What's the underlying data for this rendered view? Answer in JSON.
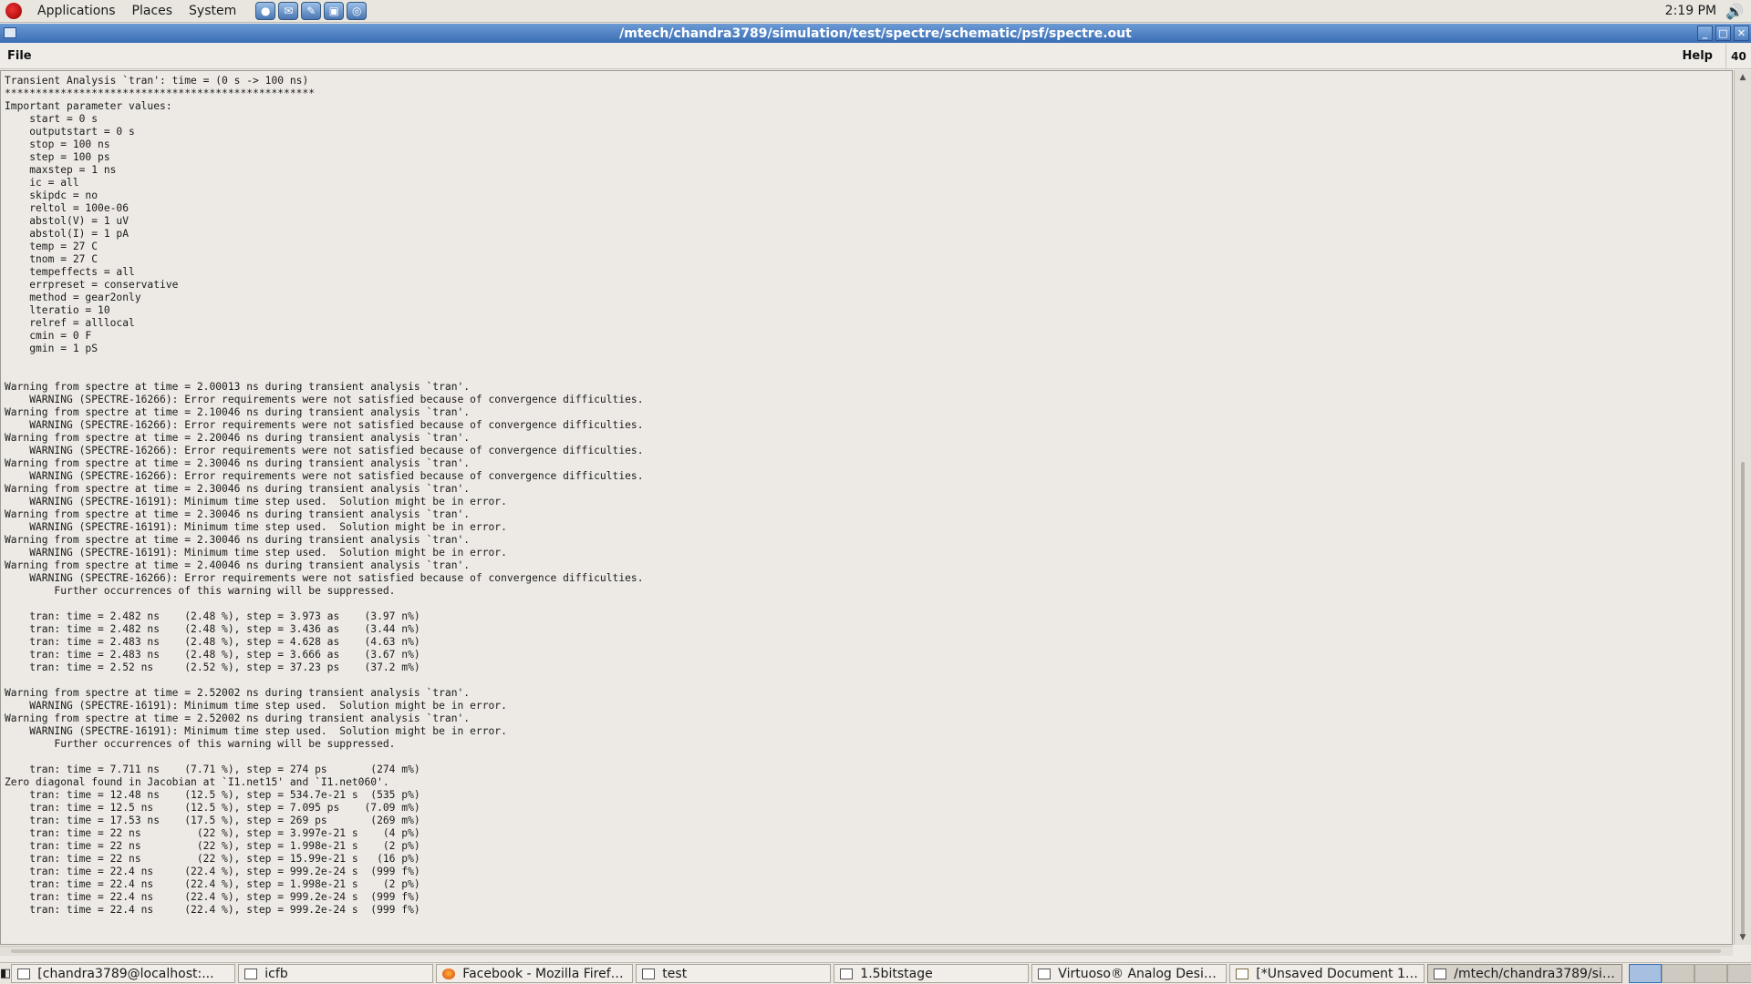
{
  "top_panel": {
    "menus": [
      "Applications",
      "Places",
      "System"
    ],
    "launchers": [
      "browser-icon",
      "email-icon",
      "editor-icon",
      "terminal-icon",
      "network-icon"
    ],
    "clock": "2:19 PM"
  },
  "window": {
    "title": "/mtech/chandra3789/simulation/test/spectre/schematic/psf/spectre.out",
    "controls": [
      "minimize",
      "maximize",
      "close"
    ]
  },
  "menubar": {
    "file": "File",
    "help": "Help",
    "counter": "40"
  },
  "log_lines": [
    "Transient Analysis `tran': time = (0 s -> 100 ns)",
    "**************************************************",
    "Important parameter values:",
    "    start = 0 s",
    "    outputstart = 0 s",
    "    stop = 100 ns",
    "    step = 100 ps",
    "    maxstep = 1 ns",
    "    ic = all",
    "    skipdc = no",
    "    reltol = 100e-06",
    "    abstol(V) = 1 uV",
    "    abstol(I) = 1 pA",
    "    temp = 27 C",
    "    tnom = 27 C",
    "    tempeffects = all",
    "    errpreset = conservative",
    "    method = gear2only",
    "    lteratio = 10",
    "    relref = alllocal",
    "    cmin = 0 F",
    "    gmin = 1 pS",
    "",
    "",
    "Warning from spectre at time = 2.00013 ns during transient analysis `tran'.",
    "    WARNING (SPECTRE-16266): Error requirements were not satisfied because of convergence difficulties.",
    "Warning from spectre at time = 2.10046 ns during transient analysis `tran'.",
    "    WARNING (SPECTRE-16266): Error requirements were not satisfied because of convergence difficulties.",
    "Warning from spectre at time = 2.20046 ns during transient analysis `tran'.",
    "    WARNING (SPECTRE-16266): Error requirements were not satisfied because of convergence difficulties.",
    "Warning from spectre at time = 2.30046 ns during transient analysis `tran'.",
    "    WARNING (SPECTRE-16266): Error requirements were not satisfied because of convergence difficulties.",
    "Warning from spectre at time = 2.30046 ns during transient analysis `tran'.",
    "    WARNING (SPECTRE-16191): Minimum time step used.  Solution might be in error.",
    "Warning from spectre at time = 2.30046 ns during transient analysis `tran'.",
    "    WARNING (SPECTRE-16191): Minimum time step used.  Solution might be in error.",
    "Warning from spectre at time = 2.30046 ns during transient analysis `tran'.",
    "    WARNING (SPECTRE-16191): Minimum time step used.  Solution might be in error.",
    "Warning from spectre at time = 2.40046 ns during transient analysis `tran'.",
    "    WARNING (SPECTRE-16266): Error requirements were not satisfied because of convergence difficulties.",
    "        Further occurrences of this warning will be suppressed.",
    "",
    "    tran: time = 2.482 ns    (2.48 %), step = 3.973 as    (3.97 n%)",
    "    tran: time = 2.482 ns    (2.48 %), step = 3.436 as    (3.44 n%)",
    "    tran: time = 2.483 ns    (2.48 %), step = 4.628 as    (4.63 n%)",
    "    tran: time = 2.483 ns    (2.48 %), step = 3.666 as    (3.67 n%)",
    "    tran: time = 2.52 ns     (2.52 %), step = 37.23 ps    (37.2 m%)",
    "",
    "Warning from spectre at time = 2.52002 ns during transient analysis `tran'.",
    "    WARNING (SPECTRE-16191): Minimum time step used.  Solution might be in error.",
    "Warning from spectre at time = 2.52002 ns during transient analysis `tran'.",
    "    WARNING (SPECTRE-16191): Minimum time step used.  Solution might be in error.",
    "        Further occurrences of this warning will be suppressed.",
    "",
    "    tran: time = 7.711 ns    (7.71 %), step = 274 ps       (274 m%)",
    "Zero diagonal found in Jacobian at `I1.net15' and `I1.net060'.",
    "    tran: time = 12.48 ns    (12.5 %), step = 534.7e-21 s  (535 p%)",
    "    tran: time = 12.5 ns     (12.5 %), step = 7.095 ps    (7.09 m%)",
    "    tran: time = 17.53 ns    (17.5 %), step = 269 ps       (269 m%)",
    "    tran: time = 22 ns         (22 %), step = 3.997e-21 s    (4 p%)",
    "    tran: time = 22 ns         (22 %), step = 1.998e-21 s    (2 p%)",
    "    tran: time = 22 ns         (22 %), step = 15.99e-21 s   (16 p%)",
    "    tran: time = 22.4 ns     (22.4 %), step = 999.2e-24 s  (999 f%)",
    "    tran: time = 22.4 ns     (22.4 %), step = 1.998e-21 s    (2 p%)",
    "    tran: time = 22.4 ns     (22.4 %), step = 999.2e-24 s  (999 f%)",
    "    tran: time = 22.4 ns     (22.4 %), step = 999.2e-24 s  (999 f%)"
  ],
  "taskbar": {
    "tasks": [
      {
        "label": "[chandra3789@localhost:...",
        "icon": "terminal-icon"
      },
      {
        "label": "icfb",
        "icon": "window-icon"
      },
      {
        "label": "Facebook - Mozilla Firefox...",
        "icon": "firefox-icon"
      },
      {
        "label": "test",
        "icon": "window-icon"
      },
      {
        "label": "1.5bitstage",
        "icon": "window-icon"
      },
      {
        "label": "Virtuoso® Analog Design ...",
        "icon": "window-icon"
      },
      {
        "label": "[*Unsaved Document 1 - ...",
        "icon": "document-icon"
      },
      {
        "label": "/mtech/chandra3789/sim...",
        "icon": "window-icon",
        "active": true
      }
    ],
    "workspaces": 4,
    "active_workspace": 1
  },
  "colors": {
    "titlebar": "#3a6eb5",
    "background": "#edeae5",
    "text": "#1a1a1a"
  }
}
